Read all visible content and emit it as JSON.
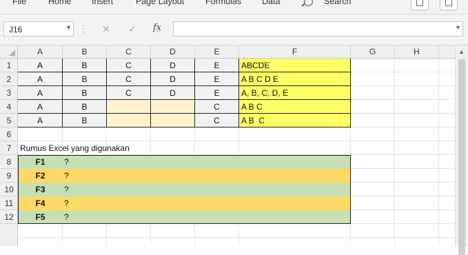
{
  "ribbon": {
    "file": "File",
    "home": "Home",
    "insert": "Insert",
    "page_layout": "Page Layout",
    "formulas": "Formulas",
    "data": "Data",
    "search": "Search"
  },
  "formula_bar": {
    "name_box": "J16",
    "cancel": "✕",
    "enter": "✓",
    "fx": "fx",
    "formula": ""
  },
  "columns": [
    "A",
    "B",
    "C",
    "D",
    "E",
    "F",
    "G",
    "H"
  ],
  "rows": [
    "1",
    "2",
    "3",
    "4",
    "5",
    "6",
    "7",
    "8",
    "9",
    "10",
    "11",
    "12"
  ],
  "table": [
    {
      "a": "A",
      "b": "B",
      "c": "C",
      "d": "D",
      "e": "E",
      "f": "ABCDE"
    },
    {
      "a": "A",
      "b": "B",
      "c": "C",
      "d": "D",
      "e": "E",
      "f": "A B C D E"
    },
    {
      "a": "A",
      "b": "B",
      "c": "C",
      "d": "D",
      "e": "E",
      "f": "A, B, C, D, E"
    },
    {
      "a": "A",
      "b": "B",
      "c": "",
      "d": "",
      "e": "C",
      "f": "A B C"
    },
    {
      "a": "A",
      "b": "B",
      "c": "",
      "d": "",
      "e": "C",
      "f": "A B  C"
    }
  ],
  "note": "Rumus Excel yang digunakan",
  "formulas": [
    {
      "label": "F1",
      "value": "?"
    },
    {
      "label": "F2",
      "value": "?"
    },
    {
      "label": "F3",
      "value": "?"
    },
    {
      "label": "F4",
      "value": "?"
    },
    {
      "label": "F5",
      "value": "?"
    }
  ],
  "colors": {
    "yellow": "#ffff66",
    "peach": "#fff2cc",
    "green": "#c6dfb4",
    "gold": "#ffd966"
  }
}
